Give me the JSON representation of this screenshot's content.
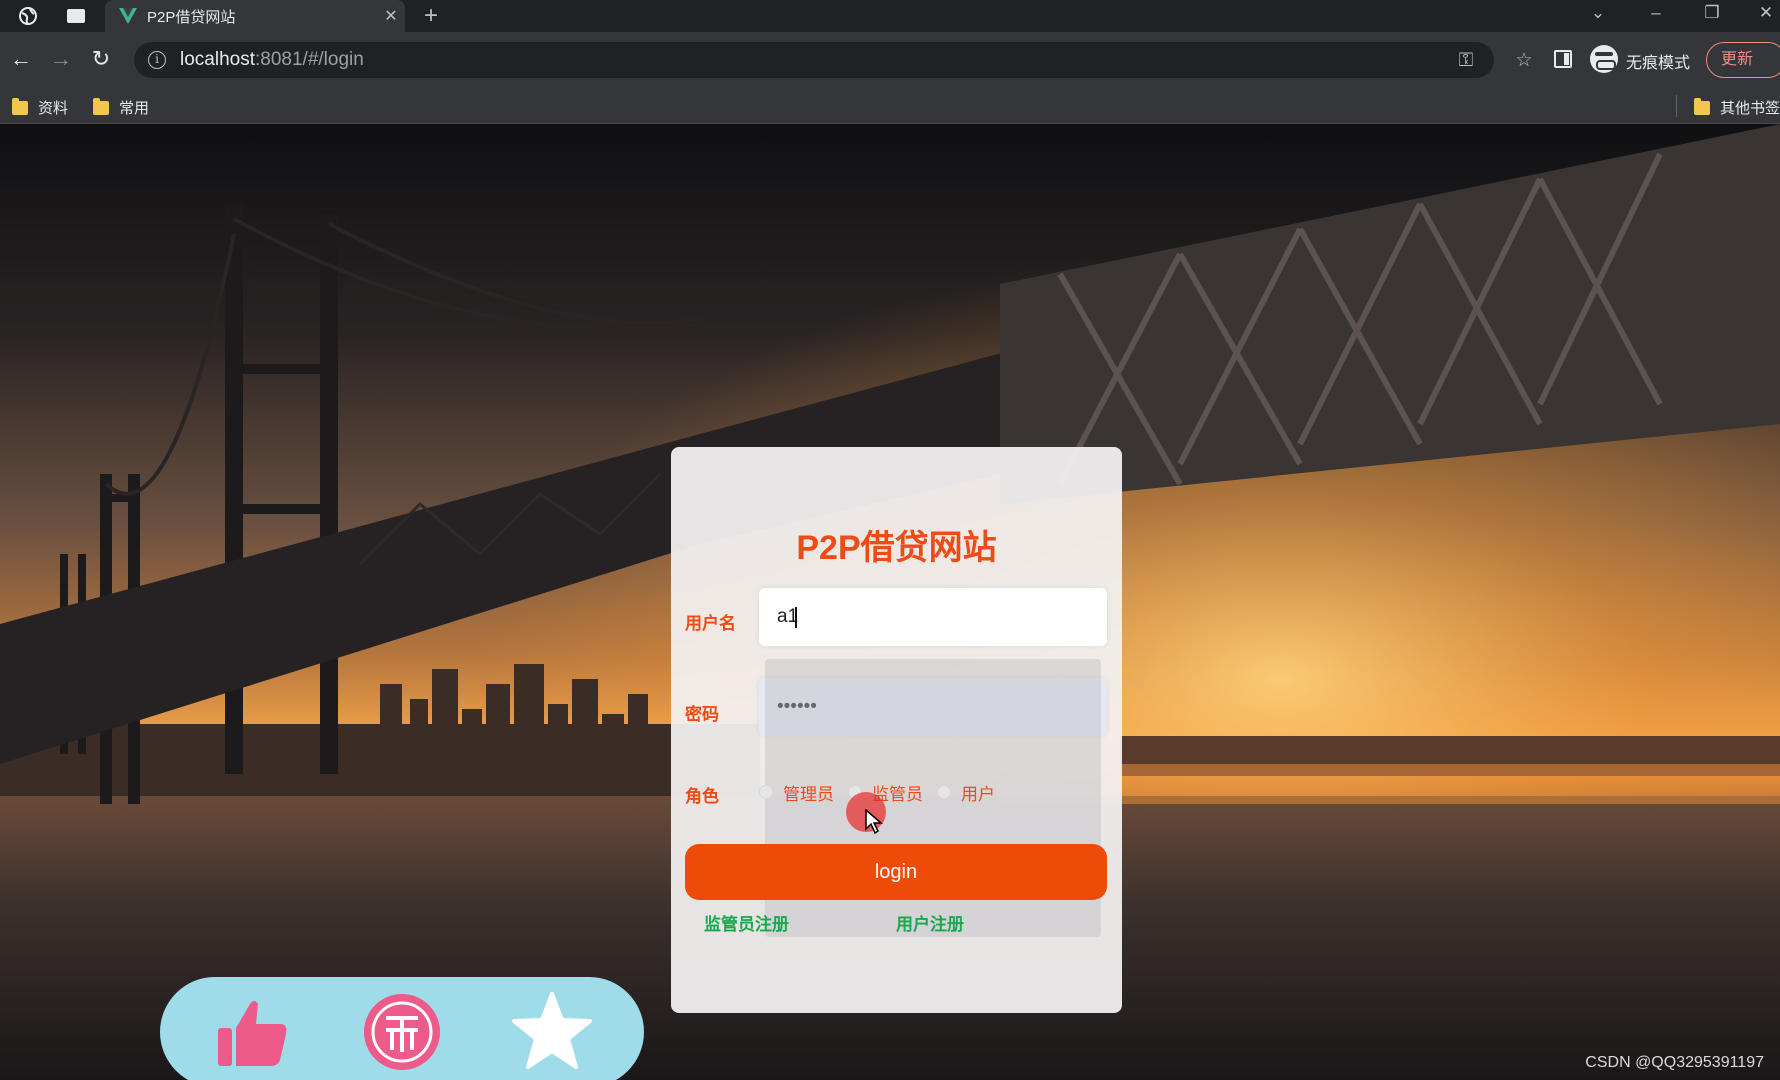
{
  "browser": {
    "tab_title": "P2P借贷网站",
    "url_host": "localhost",
    "url_path": ":8081/#/login",
    "incognito_label": "无痕模式",
    "update_label": "更新",
    "bookmarks": [
      "资料",
      "常用"
    ],
    "other_bookmarks": "其他书签"
  },
  "login": {
    "title": "P2P借贷网站",
    "username_label": "用户名",
    "username_value": "a1",
    "password_label": "密码",
    "password_value": "••••••",
    "role_label": "角色",
    "roles": [
      "管理员",
      "监管员",
      "用户"
    ],
    "login_button": "login",
    "register_links": [
      "监管员注册",
      "用户注册"
    ]
  },
  "reactions": {
    "icons": [
      "thumbs-up-icon",
      "coin-icon",
      "star-icon"
    ]
  },
  "watermark": "CSDN @QQ3295391197",
  "colors": {
    "accent": "#ee4b16",
    "link_green": "#19a74f",
    "reaction_bar": "#9fdcea",
    "reaction_pink": "#ee5a8a"
  }
}
